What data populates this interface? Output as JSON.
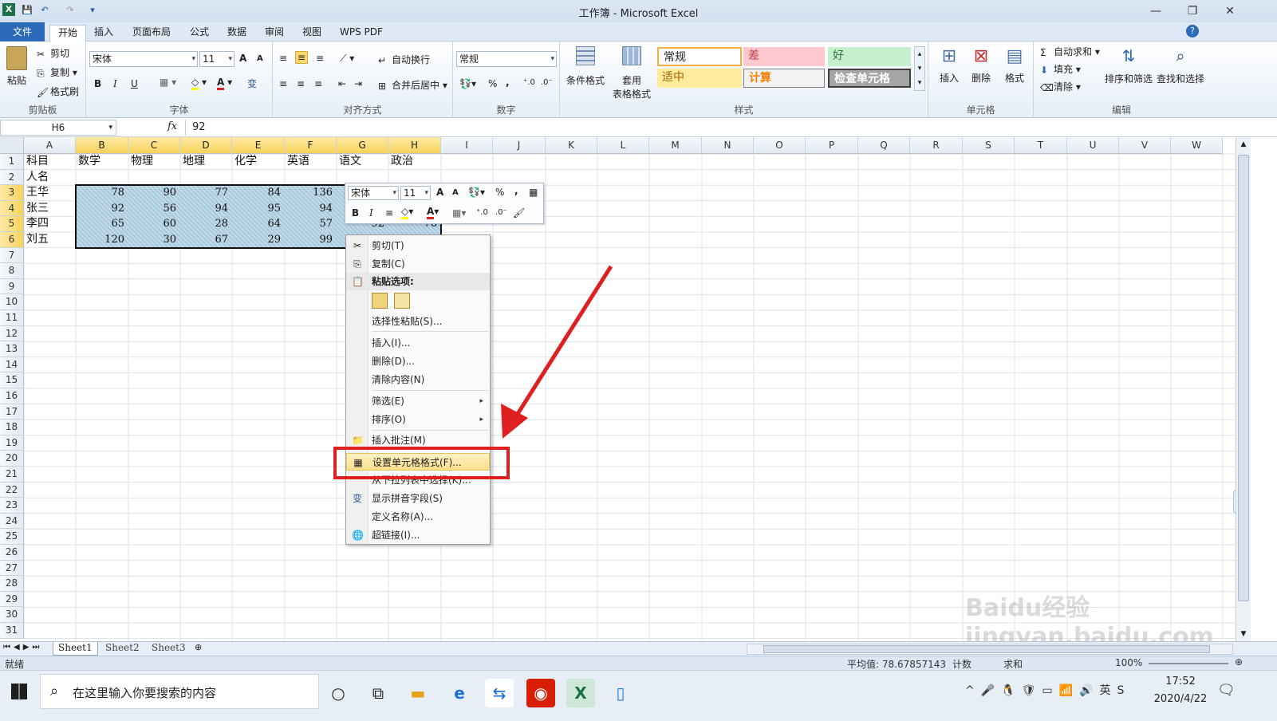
{
  "window": {
    "title": "工作簿 - Microsoft Excel"
  },
  "tabs": [
    "文件",
    "开始",
    "插入",
    "页面布局",
    "公式",
    "数据",
    "审阅",
    "视图",
    "WPS PDF"
  ],
  "ribbon": {
    "clipboard": {
      "paste": "粘贴",
      "cut": "剪切",
      "copy": "复制",
      "format_painter": "格式刷",
      "label": "剪贴板"
    },
    "font": {
      "name": "宋体",
      "size": "11",
      "label": "字体",
      "bold": "B",
      "italic": "I",
      "underline": "U",
      "grow": "A",
      "shrink": "A",
      "color_a": "A",
      "phonetic": "变"
    },
    "alignment": {
      "wrap": "自动换行",
      "merge": "合并后居中",
      "label": "对齐方式"
    },
    "number": {
      "format": "常规",
      "percent": "%",
      "comma": ",",
      "label": "数字"
    },
    "styles": {
      "cond_format": "条件格式",
      "table_format_1": "套用",
      "table_format_2": "表格格式",
      "normal": "常规",
      "bad": "差",
      "good": "好",
      "neutral": "适中",
      "calc": "计算",
      "check": "检查单元格",
      "label": "样式"
    },
    "cells": {
      "insert": "插入",
      "delete": "删除",
      "format": "格式",
      "label": "单元格"
    },
    "editing": {
      "autosum": "自动求和",
      "fill": "填充",
      "clear": "清除",
      "sort": "排序和筛选",
      "find": "查找和选择",
      "label": "编辑"
    }
  },
  "formula_bar": {
    "name_box": "H6",
    "fx": "fx",
    "value": "92"
  },
  "columns": [
    "A",
    "B",
    "C",
    "D",
    "E",
    "F",
    "G",
    "H",
    "I",
    "J",
    "K",
    "L",
    "M",
    "N",
    "O",
    "P",
    "Q",
    "R",
    "S",
    "T",
    "U",
    "V",
    "W"
  ],
  "rows": [
    "1",
    "2",
    "3",
    "4",
    "5",
    "6",
    "7",
    "8",
    "9",
    "10",
    "11",
    "12",
    "13",
    "14",
    "15",
    "16",
    "17",
    "18",
    "19",
    "20",
    "21",
    "22",
    "23",
    "24",
    "25",
    "26",
    "27",
    "28",
    "29",
    "30",
    "31"
  ],
  "sheet": {
    "header_row": [
      "科目",
      "数学",
      "物理",
      "地理",
      "化学",
      "英语",
      "语文",
      "政治"
    ],
    "row2_label": "人名",
    "data": [
      {
        "name": "王华",
        "values": [
          "78",
          "90",
          "77",
          "84",
          "136"
        ]
      },
      {
        "name": "张三",
        "values": [
          "92",
          "56",
          "94",
          "95",
          "94"
        ]
      },
      {
        "name": "李四",
        "values": [
          "65",
          "60",
          "28",
          "64",
          "57"
        ]
      },
      {
        "name": "刘五",
        "values": [
          "120",
          "30",
          "67",
          "29",
          "99"
        ]
      }
    ],
    "visible_g5": "92",
    "visible_h5": "76"
  },
  "mini_toolbar": {
    "font": "宋体",
    "size": "11",
    "bold": "B",
    "italic": "I",
    "percent": "%",
    "comma": ","
  },
  "context_menu": {
    "items": [
      {
        "label": "剪切(T)",
        "icon": "✂"
      },
      {
        "label": "复制(C)",
        "icon": "⎘"
      },
      {
        "label": "粘贴选项:",
        "icon": "📋"
      },
      {
        "label": "选择性粘贴(S)..."
      },
      {
        "label": "插入(I)..."
      },
      {
        "label": "删除(D)..."
      },
      {
        "label": "清除内容(N)"
      },
      {
        "label": "筛选(E)",
        "arrow": "▸"
      },
      {
        "label": "排序(O)",
        "arrow": "▸"
      },
      {
        "label": "插入批注(M)",
        "icon": "📁"
      },
      {
        "label": "设置单元格格式(F)...",
        "icon": "▦"
      },
      {
        "label": "从下拉列表中选择(K)..."
      },
      {
        "label": "显示拼音字段(S)",
        "icon": "变"
      },
      {
        "label": "定义名称(A)..."
      },
      {
        "label": "超链接(I)...",
        "icon": "🌐"
      }
    ]
  },
  "sheet_tabs": [
    "Sheet1",
    "Sheet2",
    "Sheet3"
  ],
  "status": {
    "ready": "就绪",
    "average": "平均值: 78.67857143",
    "count": "计数",
    "sum": "求和",
    "zoom": "100%"
  },
  "taskbar": {
    "search_placeholder": "在这里输入你要搜索的内容",
    "time": "17:52",
    "date": "2020/4/22"
  },
  "watermark": "Baidu经验 jingyan.baidu.com",
  "colors": {
    "accent": "#2a6ab8",
    "highlight": "#e02020",
    "selected_header": "#f7d35a"
  }
}
